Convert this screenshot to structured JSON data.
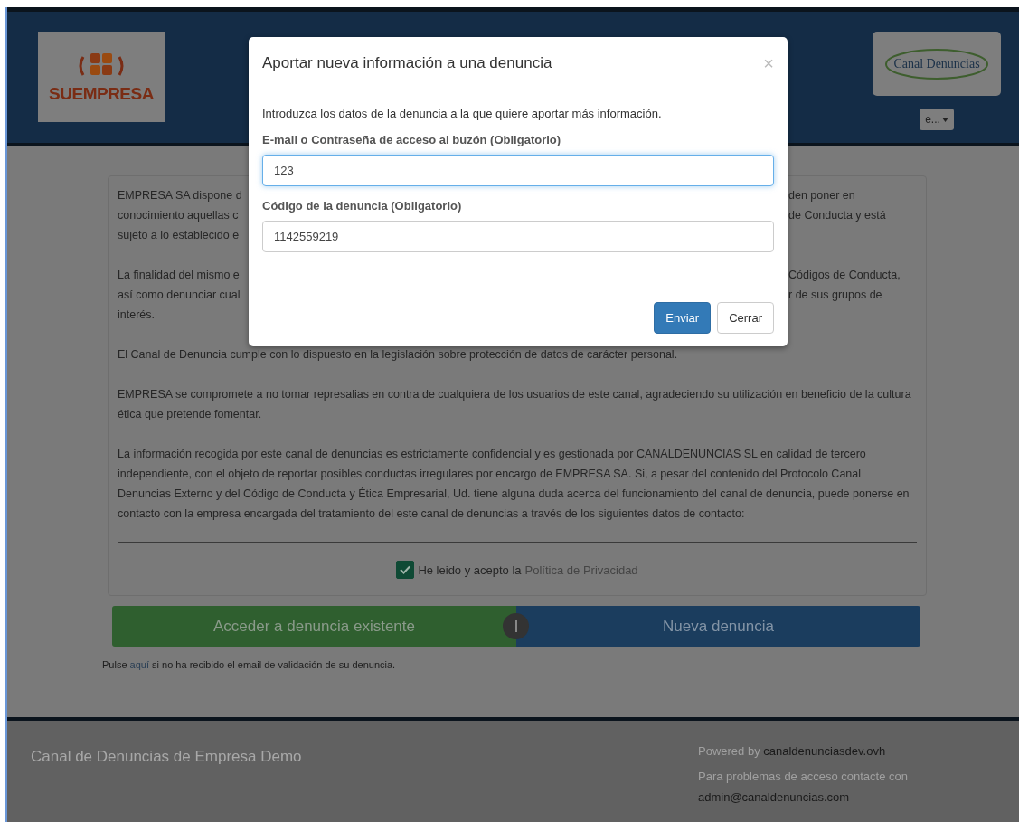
{
  "header": {
    "left_logo": {
      "text": "SUEMPRESA"
    },
    "right_logo": {
      "text": "Canal Denuncias"
    },
    "language_button": {
      "label": "e..."
    }
  },
  "content": {
    "covered_paragraphs": [
      {
        "lines": [
          {
            "left": "EMPRESA SA dispone d",
            "right": "den poner en"
          },
          {
            "left": "conocimiento aquellas c",
            "right": "de Conducta y está"
          },
          {
            "left": "sujeto a lo establecido e"
          }
        ]
      },
      {
        "lines": [
          {
            "left": "La finalidad del mismo e",
            "right": "Códigos de Conducta,"
          },
          {
            "left": "así como denunciar cual",
            "right": "r de sus grupos de"
          },
          {
            "left": "interés."
          }
        ]
      }
    ],
    "paragraphs": [
      "El Canal de Denuncia cumple con lo dispuesto en la legislación sobre protección de datos de carácter personal.",
      "EMPRESA se compromete a no tomar represalias en contra de cualquiera de los usuarios de este canal, agradeciendo su utilización en beneficio de la cultura ética que pretende fomentar.",
      "La información recogida por este canal de denuncias es estrictamente confidencial y es gestionada por CANALDENUNCIAS SL en calidad de tercero independiente, con el objeto de reportar posibles conductas irregulares por encargo de EMPRESA SA. Si, a pesar del contenido del Protocolo Canal Denuncias Externo y del Código de Conducta y Ética Empresarial, Ud. tiene alguna duda acerca del funcionamiento del canal de denuncia, puede ponerse en contacto con la empresa encargada del tratamiento del este canal de denuncias a través de los siguientes datos de contacto:"
    ],
    "consent": {
      "checked": true,
      "label": "He leido y acepto la",
      "link": "Política de Privacidad"
    },
    "actions": [
      {
        "label": "Acceder a denuncia existente",
        "kind": "existing"
      },
      {
        "label": "Nueva denuncia",
        "kind": "new"
      }
    ],
    "note": {
      "before": "Pulse",
      "link": "aquí",
      "after": "si no ha recibido el email de validación de su denuncia."
    }
  },
  "footer": {
    "title": "Canal de Denuncias de Empresa Demo",
    "powered_label": "Powered by",
    "powered_site": "canaldenunciasdev.ovh",
    "contact_label": "Para problemas de acceso contacte con",
    "contact_email": "admin@canaldenuncias.com"
  },
  "modal": {
    "title": "Aportar nueva información a una denuncia",
    "close": "×",
    "intro": "Introduzca los datos de la denuncia a la que quiere aportar más información.",
    "fields": [
      {
        "label": "E-mail o Contraseña de acceso al buzón (Obligatorio)",
        "value": "123",
        "focused": true
      },
      {
        "label": "Código de la denuncia (Obligatorio)",
        "value": "1142559219",
        "focused": false
      }
    ],
    "buttons": [
      {
        "label": "Enviar",
        "kind": "primary"
      },
      {
        "label": "Cerrar",
        "kind": "default"
      }
    ]
  }
}
